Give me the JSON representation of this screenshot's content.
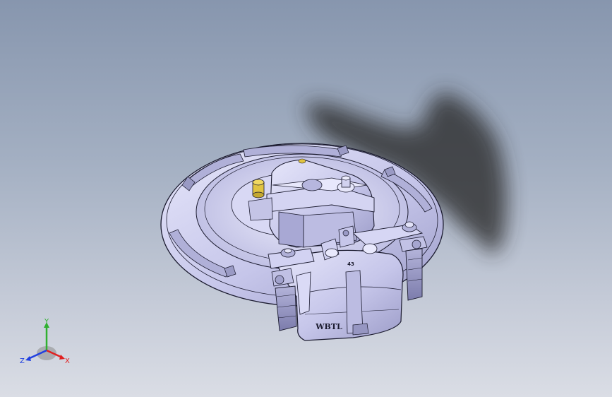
{
  "viewport": {
    "background_top": "#8796ae",
    "background_bottom": "#dadde5"
  },
  "model": {
    "housing_marking": "WBTL",
    "small_marking": "43",
    "part_color": "#c9c9ec",
    "edge_color": "#1a1a2e",
    "shadow_color": "#2a2a2a",
    "fitting_color": "#e0c341"
  },
  "triad": {
    "x_label": "X",
    "y_label": "Y",
    "z_label": "Z",
    "x_color": "#e02020",
    "y_color": "#30b030",
    "z_color": "#2040e0"
  }
}
